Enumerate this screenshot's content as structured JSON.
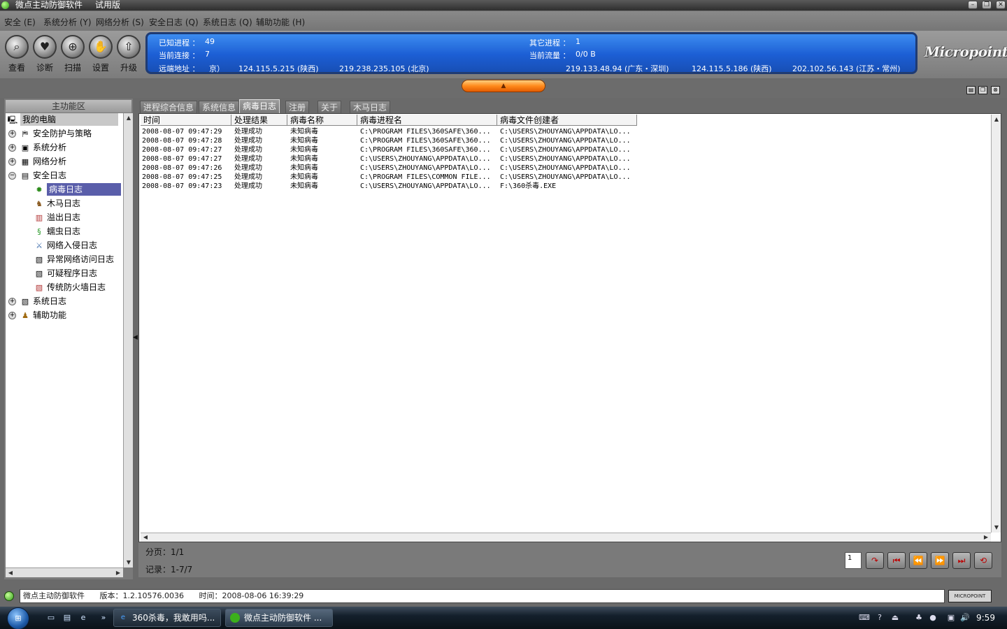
{
  "window": {
    "title": "微点主动防御软件",
    "edition": "试用版",
    "controls": [
      "minimize",
      "restore",
      "close"
    ]
  },
  "menu": [
    "安全 (E)",
    "系统分析 (Y)",
    "网络分析 (S)",
    "安全日志 (Q)",
    "系统日志 (Q)",
    "辅助功能 (H)"
  ],
  "toolbar": [
    {
      "label": "查看",
      "icon": "magnifier-icon"
    },
    {
      "label": "诊断",
      "icon": "heart-icon"
    },
    {
      "label": "扫描",
      "icon": "scan-icon"
    },
    {
      "label": "设置",
      "icon": "hand-icon"
    },
    {
      "label": "升级",
      "icon": "upgrade-icon"
    }
  ],
  "info": {
    "known_processes_label": "已知进程 ：",
    "known_processes": "49",
    "other_processes_label": "其它进程 ：",
    "other_processes": "1",
    "connections_label": "当前连接 ：",
    "connections": "7",
    "traffic_label": "当前流量 ：",
    "traffic": "0/0 B",
    "remote_label": "远端地址 ：",
    "remote": [
      "京）",
      "124.115.5.215 (陕西)",
      "219.238.235.105 (北京)",
      "219.133.48.94 (广东・深圳)",
      "124.115.5.186 (陕西)",
      "202.102.56.143 (江苏・常州)"
    ]
  },
  "logo_text": "Micropoint",
  "left_panel": {
    "header": "主功能区",
    "tree": [
      {
        "label": "我的电脑",
        "level": 0,
        "icon": "computer-icon",
        "state": "root"
      },
      {
        "label": "安全防护与策略",
        "level": 1,
        "icon": "shield-policy-icon",
        "state": "collapsed"
      },
      {
        "label": "系统分析",
        "level": 1,
        "icon": "monitor-icon",
        "state": "collapsed"
      },
      {
        "label": "网络分析",
        "level": 1,
        "icon": "network-icon",
        "state": "collapsed"
      },
      {
        "label": "安全日志",
        "level": 1,
        "icon": "log-book-icon",
        "state": "expanded"
      },
      {
        "label": "病毒日志",
        "level": 2,
        "icon": "virus-icon",
        "state": "selected"
      },
      {
        "label": "木马日志",
        "level": 2,
        "icon": "horse-icon",
        "state": ""
      },
      {
        "label": "溢出日志",
        "level": 2,
        "icon": "overflow-icon",
        "state": ""
      },
      {
        "label": "蠕虫日志",
        "level": 2,
        "icon": "worm-icon",
        "state": ""
      },
      {
        "label": "网络入侵日志",
        "level": 2,
        "icon": "sword-icon",
        "state": ""
      },
      {
        "label": "异常网络访问日志",
        "level": 2,
        "icon": "document-icon",
        "state": ""
      },
      {
        "label": "可疑程序日志",
        "level": 2,
        "icon": "document-icon",
        "state": ""
      },
      {
        "label": "传统防火墙日志",
        "level": 2,
        "icon": "firewall-icon",
        "state": ""
      },
      {
        "label": "系统日志",
        "level": 1,
        "icon": "system-log-icon",
        "state": "collapsed"
      },
      {
        "label": "辅助功能",
        "level": 1,
        "icon": "user-tools-icon",
        "state": "collapsed"
      }
    ]
  },
  "tabs": [
    {
      "label": "进程综合信息",
      "active": false
    },
    {
      "label": "系统信息",
      "active": false
    },
    {
      "label": "病毒日志",
      "active": true
    },
    {
      "label": "注册",
      "active": false
    },
    {
      "label": "关于",
      "active": false
    },
    {
      "label": "木马日志",
      "active": false
    }
  ],
  "table": {
    "columns": [
      "时间",
      "处理结果",
      "病毒名称",
      "病毒进程名",
      "病毒文件创建者"
    ],
    "rows": [
      [
        "2008-08-07 09:47:29",
        "处理成功",
        "未知病毒",
        "C:\\PROGRAM FILES\\360SAFE\\360...",
        "C:\\USERS\\ZHOUYANG\\APPDATA\\LO..."
      ],
      [
        "2008-08-07 09:47:28",
        "处理成功",
        "未知病毒",
        "C:\\PROGRAM FILES\\360SAFE\\360...",
        "C:\\USERS\\ZHOUYANG\\APPDATA\\LO..."
      ],
      [
        "2008-08-07 09:47:27",
        "处理成功",
        "未知病毒",
        "C:\\PROGRAM FILES\\360SAFE\\360...",
        "C:\\USERS\\ZHOUYANG\\APPDATA\\LO..."
      ],
      [
        "2008-08-07 09:47:27",
        "处理成功",
        "未知病毒",
        "C:\\USERS\\ZHOUYANG\\APPDATA\\LO...",
        "C:\\USERS\\ZHOUYANG\\APPDATA\\LO..."
      ],
      [
        "2008-08-07 09:47:26",
        "处理成功",
        "未知病毒",
        "C:\\USERS\\ZHOUYANG\\APPDATA\\LO...",
        "C:\\USERS\\ZHOUYANG\\APPDATA\\LO..."
      ],
      [
        "2008-08-07 09:47:25",
        "处理成功",
        "未知病毒",
        "C:\\PROGRAM FILES\\COMMON FILE...",
        "C:\\USERS\\ZHOUYANG\\APPDATA\\LO..."
      ],
      [
        "2008-08-07 09:47:23",
        "处理成功",
        "未知病毒",
        "C:\\USERS\\ZHOUYANG\\APPDATA\\LO...",
        "F:\\360杀毒.EXE"
      ]
    ]
  },
  "pager": {
    "page_text": "分页：1/1",
    "records_text": "记录：1-7/7",
    "page_input": "1",
    "buttons": [
      "go",
      "first",
      "previous",
      "next",
      "last",
      "refresh"
    ]
  },
  "status": {
    "app": "微点主动防御软件",
    "version": "版本：1.2.10576.0036",
    "time": "时间：2008-08-06 16:39:29",
    "logo": "MICROPOINT"
  },
  "taskbar": {
    "tasks": [
      "360杀毒，我敢用吗...",
      "微点主动防御软件 ..."
    ],
    "clock": "9:59"
  }
}
